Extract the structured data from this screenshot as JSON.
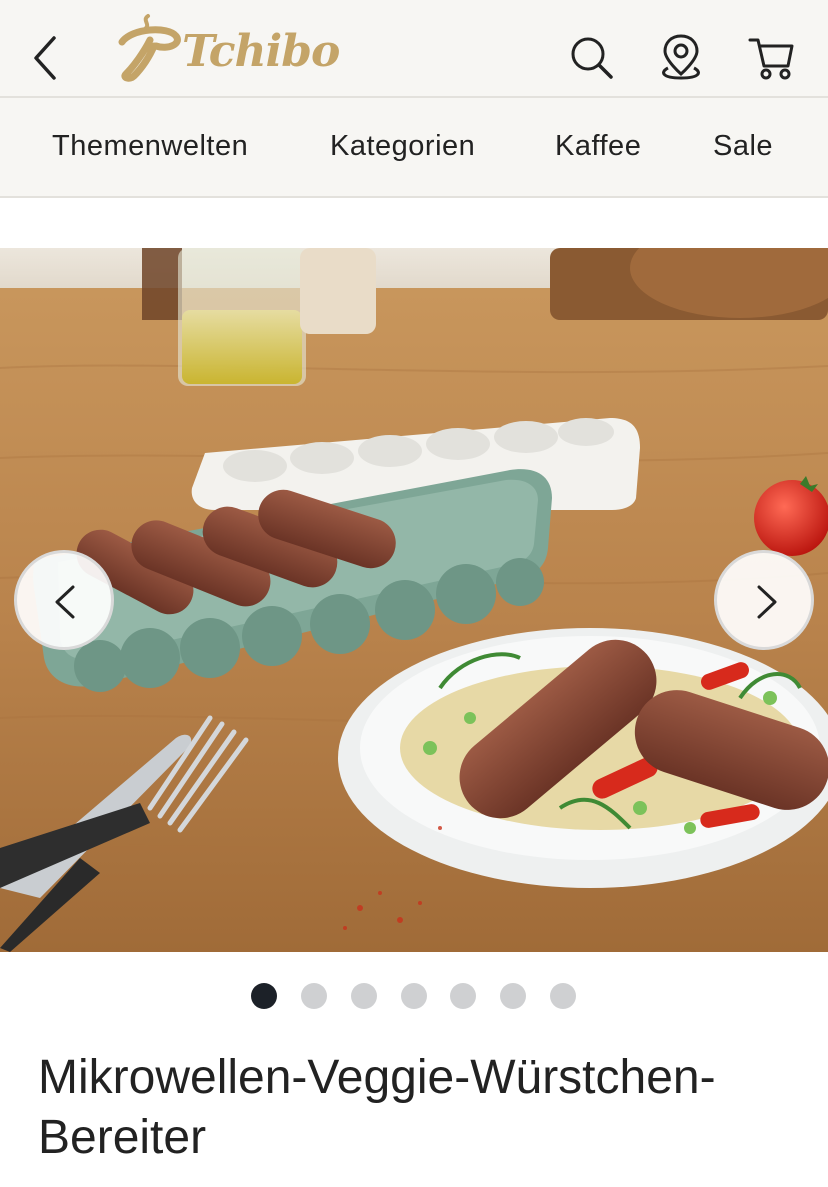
{
  "header": {
    "logo_text": "Tchibo",
    "icons": [
      "chevron-left-icon",
      "search-icon",
      "location-pin-icon",
      "cart-icon"
    ],
    "brand_color": "#c4a468"
  },
  "nav": {
    "items": [
      {
        "label": "Themenwelten"
      },
      {
        "label": "Kategorien"
      },
      {
        "label": "Kaffee"
      },
      {
        "label": "Sale"
      }
    ]
  },
  "gallery": {
    "active_index": 1,
    "total": 7,
    "icons": [
      "chevron-left-icon",
      "chevron-right-icon"
    ]
  },
  "product": {
    "title_line1": "Mikrowellen-Veggie-Würstchen-",
    "title_line2": "Bereiter"
  }
}
